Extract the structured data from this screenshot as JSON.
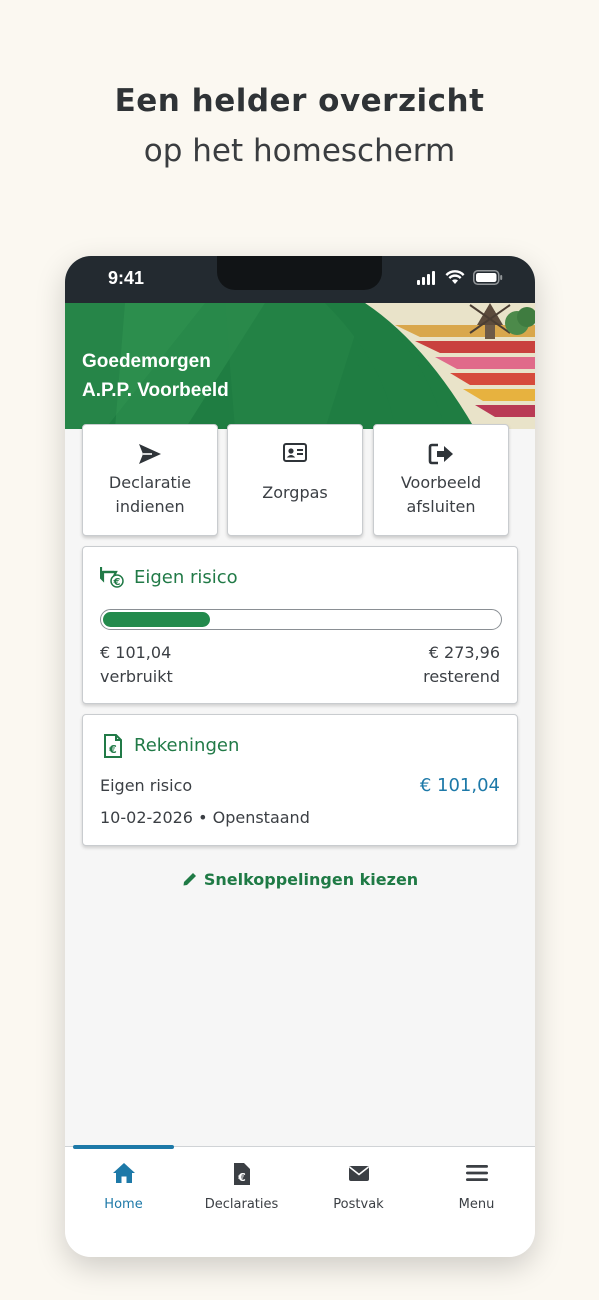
{
  "promo": {
    "headline_line1": "Een helder overzicht",
    "headline_line2": "op het homescherm"
  },
  "status_bar": {
    "time": "9:41"
  },
  "header": {
    "greeting": "Goedemorgen",
    "user_name": "A.P.P. Voorbeeld"
  },
  "tiles": [
    {
      "label_line1": "Declaratie",
      "label_line2": "indienen",
      "icon": "send-icon"
    },
    {
      "label_line1": "Zorgpas",
      "label_line2": "",
      "icon": "id-card-icon"
    },
    {
      "label_line1": "Voorbeeld",
      "label_line2": "afsluiten",
      "icon": "logout-icon"
    }
  ],
  "eigen_risico": {
    "title": "Eigen risico",
    "used_amount": "€ 101,04",
    "used_label": "verbruikt",
    "remaining_amount": "€ 273,96",
    "remaining_label": "resterend",
    "progress_fraction": 0.27
  },
  "rekeningen": {
    "title": "Rekeningen",
    "item_name": "Eigen risico",
    "item_amount": "€ 101,04",
    "item_meta": "10-02-2026 • Openstaand"
  },
  "shortcuts_link": "Snelkoppelingen kiezen",
  "tabbar": {
    "active": "Home",
    "items": [
      {
        "label": "Home",
        "icon": "home-icon"
      },
      {
        "label": "Declaraties",
        "icon": "document-euro-icon"
      },
      {
        "label": "Postvak",
        "icon": "envelope-icon"
      },
      {
        "label": "Menu",
        "icon": "hamburger-icon"
      }
    ]
  },
  "colors": {
    "brand_green": "#217a47",
    "accent_blue": "#1d79a8",
    "status_bar": "#232a30",
    "page_background": "#fbf8f1"
  }
}
